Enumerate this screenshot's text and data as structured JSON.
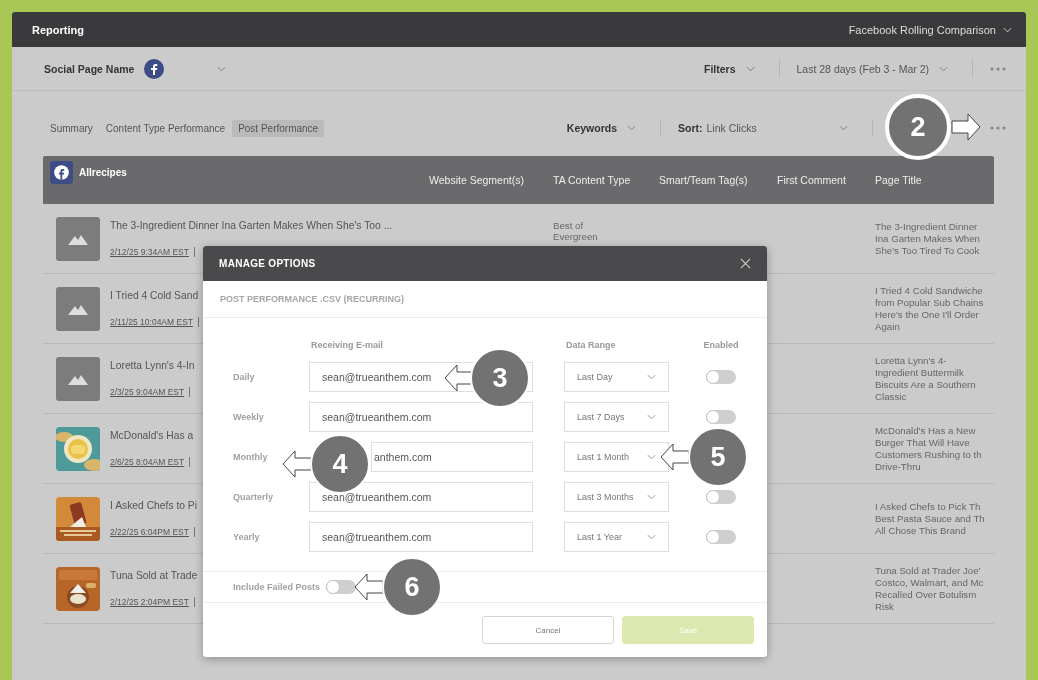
{
  "header": {
    "title": "Reporting",
    "view": "Facebook Rolling Comparison"
  },
  "toolbar": {
    "page_label": "Social Page Name",
    "filters": "Filters",
    "date_range": "Last 28 days (Feb 3 - Mar 2)"
  },
  "tabs": [
    {
      "label": "Summary",
      "selected": false
    },
    {
      "label": "Content Type Performance",
      "selected": false
    },
    {
      "label": "Post Performance",
      "selected": true
    }
  ],
  "controls": {
    "keywords": "Keywords",
    "sort_label": "Sort:",
    "sort_value": "Link Clicks"
  },
  "table": {
    "page_name": "Allrecipes",
    "columns": [
      "Website Segment(s)",
      "TA Content Type",
      "Smart/Team Tag(s)",
      "First Comment",
      "Page Title"
    ],
    "rows": [
      {
        "thumbnail": {
          "kind": "placeholder"
        },
        "title": "The 3-Ingredient Dinner Ina Garten Makes When She's Too ...",
        "date": "2/12/25 9:34AM EST",
        "content_type": [
          "Best of",
          "Evergreen"
        ],
        "page_title": [
          "The 3-Ingredient Dinner",
          "Ina Garten Makes When",
          "She's Too Tired To Cook"
        ]
      },
      {
        "thumbnail": {
          "kind": "placeholder"
        },
        "title": "I Tried 4 Cold Sand",
        "date": "2/11/25 10:04AM EST",
        "page_title": [
          "I Tried 4 Cold Sandwiche",
          "from Popular Sub Chains",
          "Here's the One I'll Order",
          "Again"
        ]
      },
      {
        "thumbnail": {
          "kind": "placeholder"
        },
        "title": "Loretta Lynn's 4-In",
        "date": "2/3/25 9:04AM EST",
        "page_title": [
          "Loretta Lynn's 4-",
          "Ingredient Buttermilk",
          "Biscuits Are a Southern",
          "Classic"
        ]
      },
      {
        "thumbnail": {
          "kind": "picture"
        },
        "title": "McDonald's Has a",
        "date": "2/6/25 8:04AM EST",
        "page_title": [
          "McDonald's Has a New",
          "Burger That Will Have",
          "Customers Rushing to th",
          "Drive-Thru"
        ]
      },
      {
        "thumbnail": {
          "kind": "picture"
        },
        "title": "I Asked Chefs to Pi",
        "date": "2/22/25 6:04PM EST",
        "page_title": [
          "I Asked Chefs to Pick Th",
          "Best Pasta Sauce and Th",
          "All Chose This Brand"
        ]
      },
      {
        "thumbnail": {
          "kind": "picture"
        },
        "title": "Tuna Sold at Trade",
        "date": "2/12/25 2:04PM EST",
        "page_title": [
          "Tuna Sold at Trader Joe'",
          "Costco, Walmart, and Mc",
          "Recalled Over Botulism",
          "Risk"
        ]
      }
    ]
  },
  "modal": {
    "title": "MANAGE OPTIONS",
    "subtitle": "POST PERFORMANCE .CSV (RECURRING)",
    "columns": [
      "Receiving E-mail",
      "Data Range",
      "Enabled"
    ],
    "schedules": [
      {
        "label": "Daily",
        "email": "sean@trueanthem.com",
        "range": "Last Day",
        "enabled": false
      },
      {
        "label": "Weekly",
        "email": "sean@trueanthem.com",
        "range": "Last 7 Days",
        "enabled": false
      },
      {
        "label": "Monthly",
        "email": "anthem.com",
        "email_partly_hidden": true,
        "range": "Last 1 Month"
      },
      {
        "label": "Quarterly",
        "email": "sean@trueanthem.com",
        "range": "Last 3 Months",
        "enabled": false
      },
      {
        "label": "Yearly",
        "email": "sean@trueanthem.com",
        "range": "Last 1 Year",
        "enabled": false
      }
    ],
    "include_failed": {
      "label": "Include Failed Posts",
      "on": false
    },
    "buttons": [
      {
        "label": "Cancel",
        "disabled": false
      },
      {
        "label": "Save",
        "disabled": true
      }
    ]
  },
  "callouts": [
    {
      "number": "2"
    },
    {
      "number": "3"
    },
    {
      "number": "4"
    },
    {
      "number": "5"
    },
    {
      "number": "6"
    }
  ]
}
